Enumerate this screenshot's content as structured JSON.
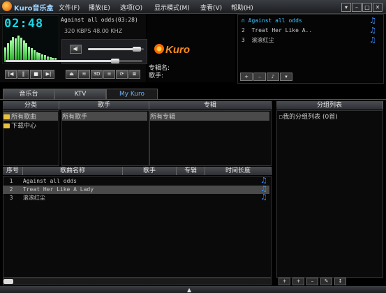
{
  "app": {
    "title": "Kuro音乐盒"
  },
  "menu": [
    "文件(F)",
    "播放(E)",
    "选项(O)",
    "显示模式(M)",
    "查看(V)",
    "帮助(H)"
  ],
  "player": {
    "time": "02:48",
    "track": "Against all odds(03:28)",
    "bitrate_line": "320 KBPS 48.00 KHZ",
    "volume_pct": 88,
    "progress_pct": 80,
    "spectrum": [
      30,
      38,
      45,
      52,
      48,
      55,
      50,
      44,
      38,
      32,
      28,
      24,
      20,
      18,
      16,
      14,
      12,
      10,
      9,
      8
    ]
  },
  "album": {
    "album_label": "专辑名:",
    "artist_label": "歌手:"
  },
  "playlist": {
    "items": [
      {
        "num": "1",
        "title": "Against all odds",
        "active": true
      },
      {
        "num": "2",
        "title": "Treat Her Like A..",
        "active": false
      },
      {
        "num": "3",
        "title": "滚滚红尘",
        "active": false
      }
    ]
  },
  "tabs": [
    "音乐台",
    "KTV",
    "My Kuro"
  ],
  "browser": {
    "headers": [
      "分类",
      "歌手",
      "专辑",
      "分组列表"
    ],
    "categories": [
      "所有歌曲",
      "下载中心"
    ],
    "artists": [
      "所有歌手"
    ],
    "albums": [
      "所有专辑"
    ],
    "groups": [
      "我的分组列表 (0首)"
    ]
  },
  "songs": {
    "headers": [
      "序号",
      "歌曲名称",
      "歌手",
      "专辑",
      "时间长度"
    ],
    "rows": [
      {
        "num": "1",
        "title": "Against all odds"
      },
      {
        "num": "2",
        "title": "Treat Her Like A Lady"
      },
      {
        "num": "3",
        "title": "滚滚红尘"
      }
    ]
  },
  "colors": {
    "accent": "#6ab4ff",
    "lcd": "#19d7e6",
    "spectrum": "#44cc44"
  },
  "icons": [
    "logo-icon",
    "folder-icon",
    "note-icon",
    "prev-icon",
    "pause-icon",
    "stop-icon",
    "next-icon",
    "eject-icon",
    "minimize-icon",
    "maximize-icon",
    "close-icon"
  ]
}
